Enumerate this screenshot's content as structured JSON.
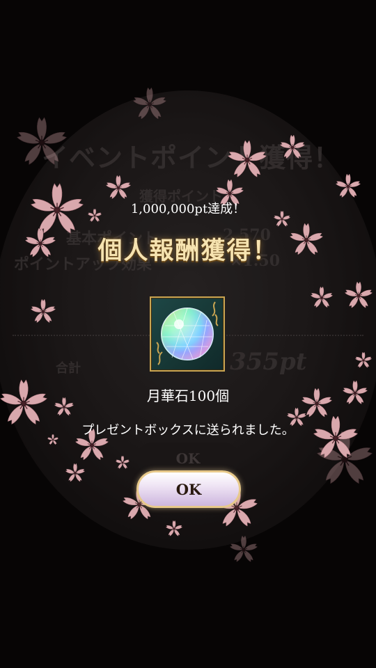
{
  "background": {
    "title": "イベントポイント獲得！",
    "line1": "獲得ポイント",
    "line2_label": "基本ポイント",
    "line2_value": "2,570",
    "line3_label": "ポイントアップ効果",
    "line3_value": "×1.50",
    "total_label": "合計",
    "total_value": "355pt",
    "ok_label": "OK"
  },
  "modal": {
    "achievement": "1,000,000pt達成！",
    "title": "個人報酬獲得！",
    "item_name": "月華石100個",
    "message": "プレゼントボックスに送られました。",
    "ok_label": "OK"
  },
  "colors": {
    "accent_gold": "#f6e3b0",
    "frame_gold": "#c9a552",
    "blossom_pink": "#d9a8ad"
  }
}
